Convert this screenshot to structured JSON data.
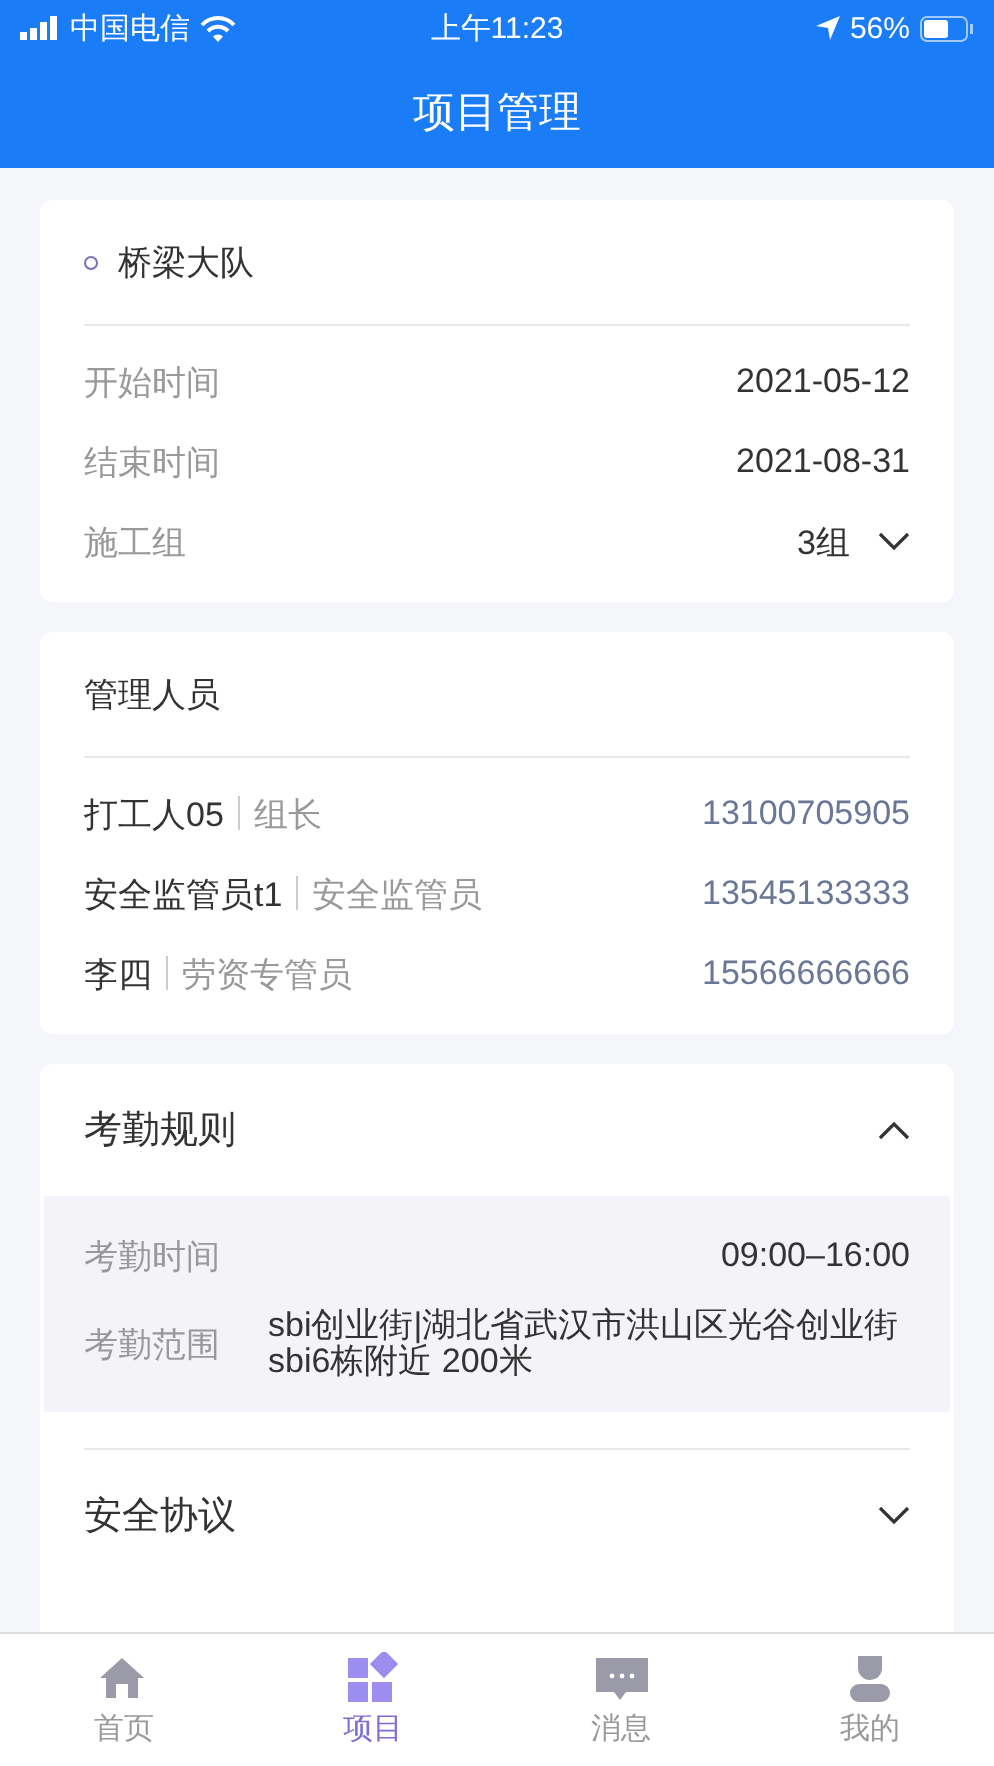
{
  "status_bar": {
    "carrier": "中国电信",
    "time": "上午11:23",
    "battery": "56%"
  },
  "header": {
    "title": "项目管理"
  },
  "project": {
    "name": "桥梁大队",
    "fields": [
      {
        "label": "开始时间",
        "value": "2021-05-12",
        "kind": "text"
      },
      {
        "label": "结束时间",
        "value": "2021-08-31",
        "kind": "text"
      },
      {
        "label": "施工组",
        "value": "3组",
        "kind": "dropdown"
      }
    ]
  },
  "managers": {
    "title": "管理人员",
    "people": [
      {
        "name": "打工人05",
        "role": "组长",
        "phone": "13100705905"
      },
      {
        "name": "安全监管员t1",
        "role": "安全监管员",
        "phone": "13545133333"
      },
      {
        "name": "李四",
        "role": "劳资专管员",
        "phone": "15566666666"
      }
    ]
  },
  "sections": [
    {
      "title": "考勤规则",
      "expanded": true,
      "details": [
        {
          "label": "考勤时间",
          "value": "09:00–16:00"
        },
        {
          "label": "考勤范围",
          "value": "sbi创业街|湖北省武汉市洪山区光谷创业街sbi6栋附近 200米"
        }
      ]
    },
    {
      "title": "安全协议",
      "expanded": false
    }
  ],
  "tab_bar": [
    {
      "label": "首页",
      "selected": false
    },
    {
      "label": "项目",
      "selected": true
    },
    {
      "label": "消息",
      "selected": false
    },
    {
      "label": "我的",
      "selected": false
    }
  ]
}
